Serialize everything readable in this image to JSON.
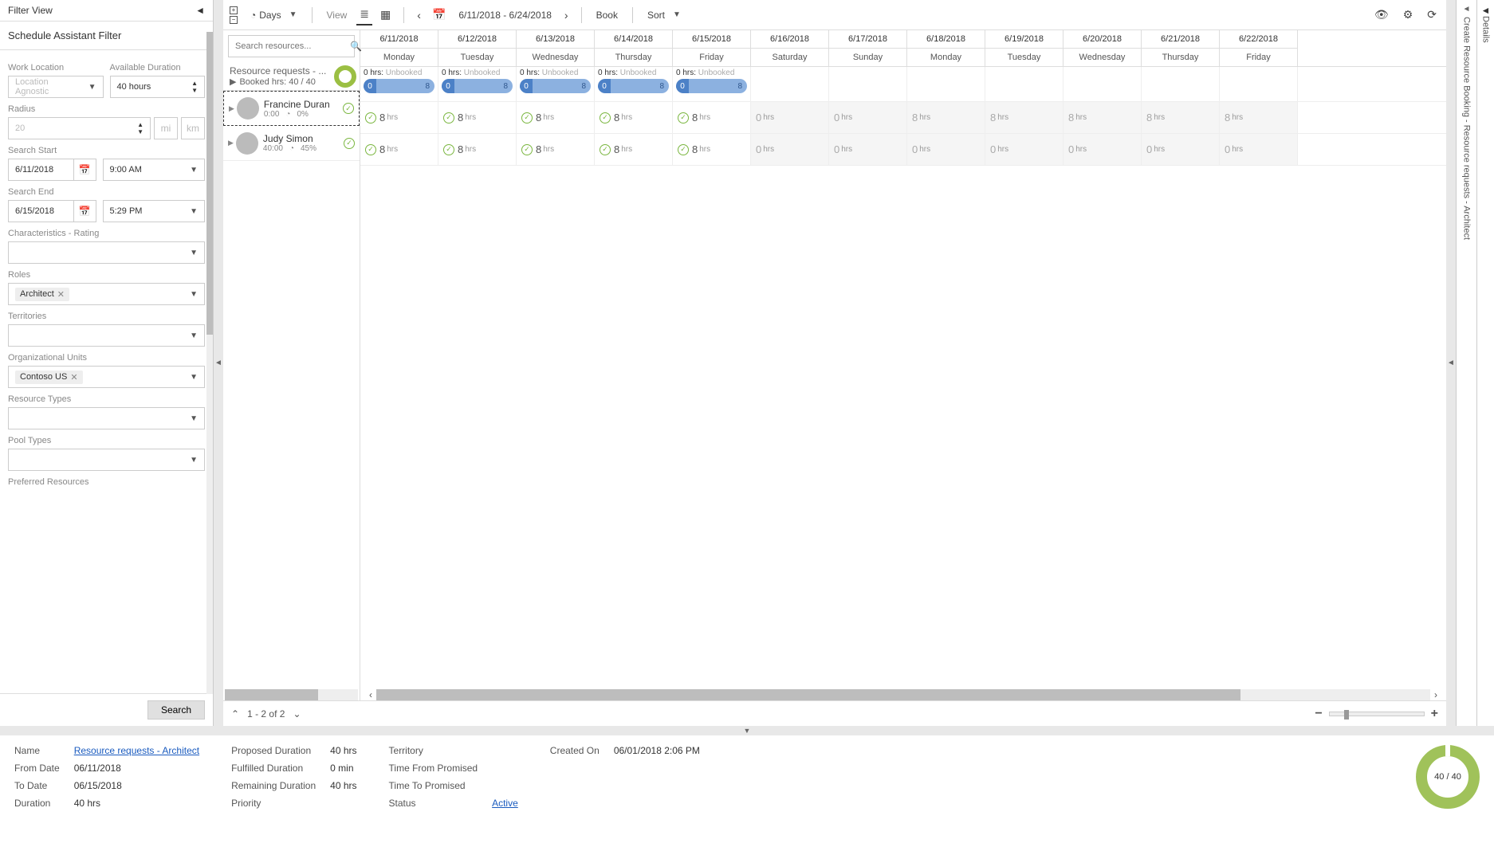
{
  "filterView": {
    "title": "Filter View",
    "subtitle": "Schedule Assistant Filter",
    "workLocation": {
      "label": "Work Location",
      "value": "Location Agnostic"
    },
    "availableDuration": {
      "label": "Available Duration",
      "value": "40 hours"
    },
    "radius": {
      "label": "Radius",
      "value": "20",
      "unit_mi": "mi",
      "unit_km": "km"
    },
    "searchStart": {
      "label": "Search Start",
      "date": "6/11/2018",
      "time": "9:00 AM"
    },
    "searchEnd": {
      "label": "Search End",
      "date": "6/15/2018",
      "time": "5:29 PM"
    },
    "characteristics": {
      "label": "Characteristics - Rating"
    },
    "roles": {
      "label": "Roles",
      "chip": "Architect"
    },
    "territories": {
      "label": "Territories"
    },
    "orgUnits": {
      "label": "Organizational Units",
      "chip": "Contoso US"
    },
    "resourceTypes": {
      "label": "Resource Types"
    },
    "poolTypes": {
      "label": "Pool Types"
    },
    "preferred": {
      "label": "Preferred Resources"
    },
    "searchBtn": "Search"
  },
  "toolbar": {
    "days": "Days",
    "view": "View",
    "range": "6/11/2018 - 6/24/2018",
    "book": "Book",
    "sort": "Sort"
  },
  "search": {
    "placeholder": "Search resources..."
  },
  "requestHeader": {
    "title": "Resource requests - ...",
    "booked": "Booked hrs: 40 / 40"
  },
  "resources": [
    {
      "name": "Francine Duran",
      "hrs": "0:00",
      "pct": "0%"
    },
    {
      "name": "Judy Simon",
      "hrs": "40:00",
      "pct": "45%"
    }
  ],
  "days": [
    {
      "date": "6/11/2018",
      "dow": "Monday",
      "unbooked": "0 hrs:",
      "pill0": "0",
      "pill8": "8",
      "r1": "8",
      "r2": "8",
      "type": "avail"
    },
    {
      "date": "6/12/2018",
      "dow": "Tuesday",
      "unbooked": "0 hrs:",
      "pill0": "0",
      "pill8": "8",
      "r1": "8",
      "r2": "8",
      "type": "avail"
    },
    {
      "date": "6/13/2018",
      "dow": "Wednesday",
      "unbooked": "0 hrs:",
      "pill0": "0",
      "pill8": "8",
      "r1": "8",
      "r2": "8",
      "type": "avail"
    },
    {
      "date": "6/14/2018",
      "dow": "Thursday",
      "unbooked": "0 hrs:",
      "pill0": "0",
      "pill8": "8",
      "r1": "8",
      "r2": "8",
      "type": "avail"
    },
    {
      "date": "6/15/2018",
      "dow": "Friday",
      "unbooked": "0 hrs:",
      "pill0": "0",
      "pill8": "8",
      "r1": "8",
      "r2": "8",
      "type": "avail"
    },
    {
      "date": "6/16/2018",
      "dow": "Saturday",
      "r1": "0",
      "r2": "0",
      "type": "none"
    },
    {
      "date": "6/17/2018",
      "dow": "Sunday",
      "r1": "0",
      "r2": "0",
      "type": "none"
    },
    {
      "date": "6/18/2018",
      "dow": "Monday",
      "r1": "8",
      "r2": "0",
      "type": "none"
    },
    {
      "date": "6/19/2018",
      "dow": "Tuesday",
      "r1": "8",
      "r2": "0",
      "type": "none"
    },
    {
      "date": "6/20/2018",
      "dow": "Wednesday",
      "r1": "8",
      "r2": "0",
      "type": "none"
    },
    {
      "date": "6/21/2018",
      "dow": "Thursday",
      "r1": "8",
      "r2": "0",
      "type": "none"
    },
    {
      "date": "6/22/2018",
      "dow": "Friday",
      "r1": "8",
      "r2": "0",
      "type": "none"
    }
  ],
  "unbookedText": "Unbooked",
  "hrsLabel": "hrs",
  "footer": {
    "pager": "1 - 2 of 2"
  },
  "detailsRail": {
    "text": "Details"
  },
  "createRail": {
    "text": "Create Resource Booking - Resource requests - Architect"
  },
  "detail": {
    "name_l": "Name",
    "name_v": "Resource requests - Architect",
    "from_l": "From Date",
    "from_v": "06/11/2018",
    "to_l": "To Date",
    "to_v": "06/15/2018",
    "dur_l": "Duration",
    "dur_v": "40 hrs",
    "prop_l": "Proposed Duration",
    "prop_v": "40 hrs",
    "fulf_l": "Fulfilled Duration",
    "fulf_v": "0 min",
    "rem_l": "Remaining Duration",
    "rem_v": "40 hrs",
    "prio_l": "Priority",
    "terr_l": "Territory",
    "timefrom_l": "Time From Promised",
    "timeto_l": "Time To Promised",
    "status_l": "Status",
    "status_v": "Active",
    "created_l": "Created On",
    "created_v": "06/01/2018 2:06 PM",
    "donut": "40 / 40"
  }
}
